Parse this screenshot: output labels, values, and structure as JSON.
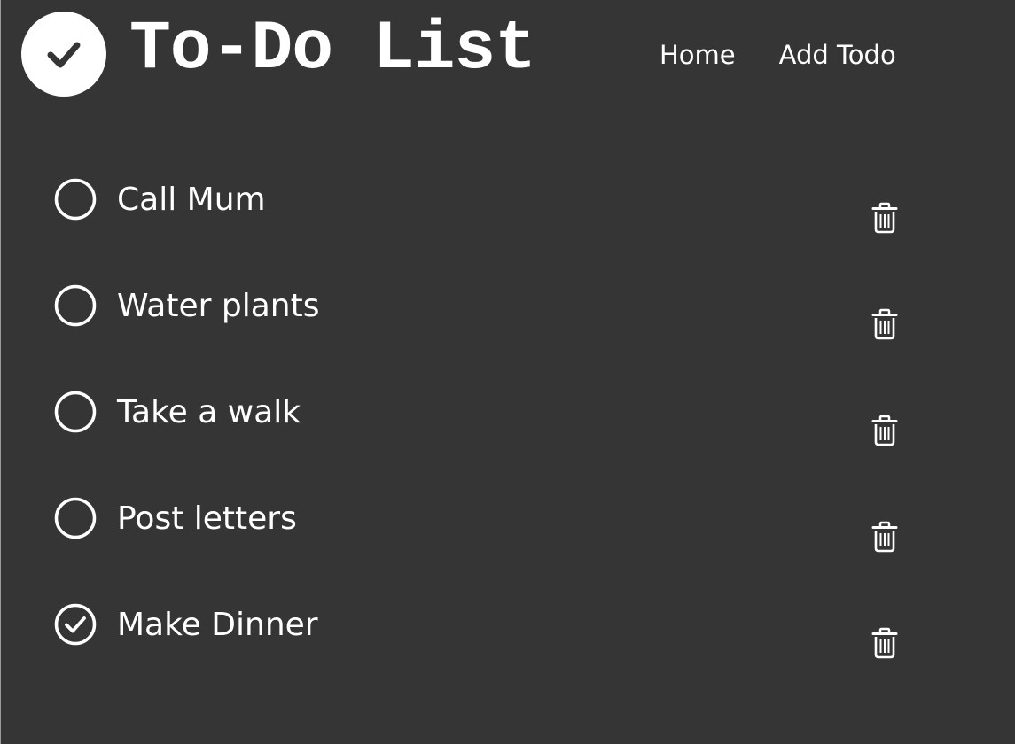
{
  "header": {
    "logo_icon": "checkmark-icon",
    "title": "To-Do List",
    "nav": [
      {
        "label": "Home"
      },
      {
        "label": "Add Todo"
      }
    ]
  },
  "todos": [
    {
      "label": "Call Mum",
      "completed": false
    },
    {
      "label": "Water plants",
      "completed": false
    },
    {
      "label": "Take a walk",
      "completed": false
    },
    {
      "label": "Post letters",
      "completed": false
    },
    {
      "label": "Make Dinner",
      "completed": true
    }
  ],
  "icons": {
    "unchecked": "empty-circle-icon",
    "checked": "check-circle-icon",
    "delete": "trash-icon"
  },
  "colors": {
    "background": "#353535",
    "foreground": "#ffffff",
    "logo_check": "#353535"
  }
}
